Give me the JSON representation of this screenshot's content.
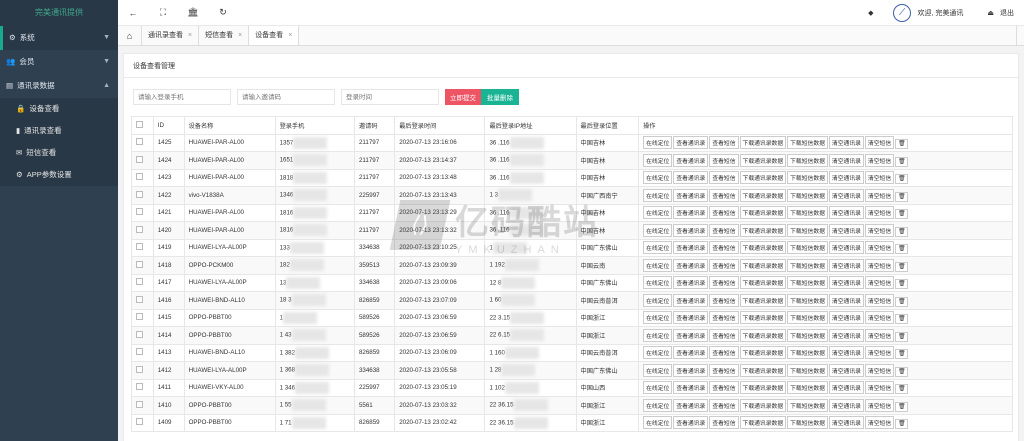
{
  "brand": "完美通讯提供",
  "sidebar": {
    "items": [
      {
        "label": "系统",
        "icon": "gear-icon"
      },
      {
        "label": "会员",
        "icon": "users-icon"
      },
      {
        "label": "通讯录数据",
        "icon": "list-icon"
      }
    ],
    "subitems": [
      {
        "label": "设备查看",
        "icon": "lock-icon"
      },
      {
        "label": "通讯录查看",
        "icon": "book-icon"
      },
      {
        "label": "短信查看",
        "icon": "envelope-icon"
      },
      {
        "label": "APP参数设置",
        "icon": "gear-icon"
      }
    ]
  },
  "topbar": {
    "welcome": "欢迎, 完美通讯",
    "logout": "退出"
  },
  "tabs": [
    {
      "label": "通讯录查看"
    },
    {
      "label": "短信查看"
    },
    {
      "label": "设备查看"
    }
  ],
  "panel": {
    "title": "设备查看管理"
  },
  "filters": {
    "phone_placeholder": "请输入登录手机",
    "invite_placeholder": "请输入邀请码",
    "time_placeholder": "登录时间",
    "submit": "立即提交",
    "batch_delete": "批量删除"
  },
  "table": {
    "headers": [
      "ID",
      "设备名称",
      "登录手机",
      "邀请码",
      "最后登录时间",
      "最后登录IP地址",
      "最后登录位置",
      "操作"
    ],
    "actions": [
      "在线定位",
      "查看通讯录",
      "查看短信",
      "下载通讯录数据",
      "下载短信数据",
      "清空通讯录",
      "清空短信",
      "🗑"
    ],
    "rows": [
      {
        "id": "1425",
        "device": "HUAWEI-PAR-AL00",
        "phone": "1357",
        "code": "211797",
        "time": "2020-07-13 23:16:06",
        "ip": "36 .116",
        "loc": "中国吉林"
      },
      {
        "id": "1424",
        "device": "HUAWEI-PAR-AL00",
        "phone": "1651",
        "code": "211797",
        "time": "2020-07-13 23:14:37",
        "ip": "36 .116",
        "loc": "中国吉林"
      },
      {
        "id": "1423",
        "device": "HUAWEI-PAR-AL00",
        "phone": "1818",
        "code": "211797",
        "time": "2020-07-13 23:13:48",
        "ip": "36 .116",
        "loc": "中国吉林"
      },
      {
        "id": "1422",
        "device": "vivo-V1838A",
        "phone": "1346",
        "code": "225997",
        "time": "2020-07-13 23:13:43",
        "ip": "1 3",
        "loc": "中国广西南宁"
      },
      {
        "id": "1421",
        "device": "HUAWEI-PAR-AL00",
        "phone": "1816",
        "code": "211797",
        "time": "2020-07-13 23:13:29",
        "ip": "36 .116",
        "loc": "中国吉林"
      },
      {
        "id": "1420",
        "device": "HUAWEI-PAR-AL00",
        "phone": "1816",
        "code": "211797",
        "time": "2020-07-13 23:13:32",
        "ip": "36 .116",
        "loc": "中国吉林"
      },
      {
        "id": "1419",
        "device": "HUAWEI-LYA-AL00P",
        "phone": "133",
        "code": "334638",
        "time": "2020-07-13 23:10:25",
        "ip": "1",
        "loc": "中国广东佛山"
      },
      {
        "id": "1418",
        "device": "OPPO-PCKM00",
        "phone": "182",
        "code": "359513",
        "time": "2020-07-13 23:09:39",
        "ip": "1 192",
        "loc": "中国云南"
      },
      {
        "id": "1417",
        "device": "HUAWEI-LYA-AL00P",
        "phone": "13",
        "code": "334638",
        "time": "2020-07-13 23:09:06",
        "ip": "12 8",
        "loc": "中国广东佛山"
      },
      {
        "id": "1416",
        "device": "HUAWEI-BND-AL10",
        "phone": "18 3",
        "code": "826859",
        "time": "2020-07-13 23:07:09",
        "ip": "1 60",
        "loc": "中国云南普洱"
      },
      {
        "id": "1415",
        "device": "OPPO-PBBT00",
        "phone": "1",
        "code": "589526",
        "time": "2020-07-13 23:06:59",
        "ip": "22 3.15",
        "loc": "中国浙江"
      },
      {
        "id": "1414",
        "device": "OPPO-PBBT00",
        "phone": "1 43",
        "code": "589526",
        "time": "2020-07-13 23:06:59",
        "ip": "22 6.15",
        "loc": "中国浙江"
      },
      {
        "id": "1413",
        "device": "HUAWEI-BND-AL10",
        "phone": "1 382",
        "code": "826859",
        "time": "2020-07-13 23:06:09",
        "ip": "1 160",
        "loc": "中国云南普洱"
      },
      {
        "id": "1412",
        "device": "HUAWEI-LYA-AL00P",
        "phone": "1 368",
        "code": "334638",
        "time": "2020-07-13 23:05:58",
        "ip": "1 28",
        "loc": "中国广东佛山"
      },
      {
        "id": "1411",
        "device": "HUAWEI-VKY-AL00",
        "phone": "1 346",
        "code": "225997",
        "time": "2020-07-13 23:05:19",
        "ip": "1 102",
        "loc": "中国山西"
      },
      {
        "id": "1410",
        "device": "OPPO-PBBT00",
        "phone": "1 55",
        "code": "5561",
        "time": "2020-07-13 23:03:32",
        "ip": "22 36.15",
        "loc": "中国浙江"
      },
      {
        "id": "1409",
        "device": "OPPO-PBBT00",
        "phone": "1 71",
        "code": "826859",
        "time": "2020-07-13 23:02:42",
        "ip": "22 36.15",
        "loc": "中国浙江"
      }
    ]
  },
  "watermark": {
    "cn": "亿码酷站",
    "en": "YMKUZHAN"
  }
}
